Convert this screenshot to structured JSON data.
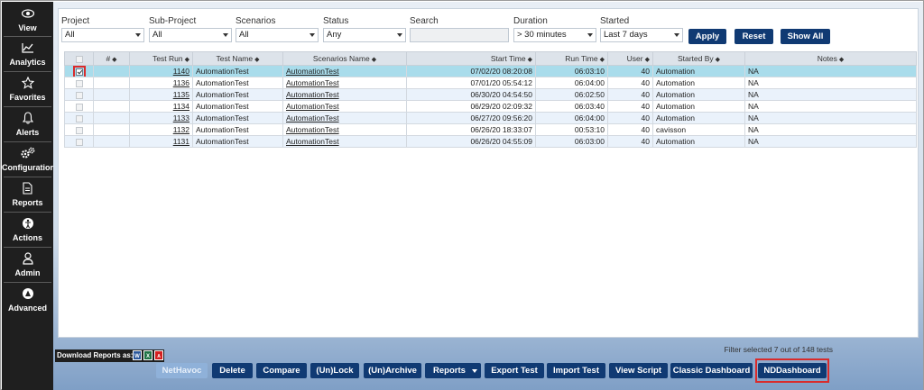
{
  "sidebar": {
    "items": [
      {
        "label": "View",
        "icon": "eye-icon"
      },
      {
        "label": "Analytics",
        "icon": "line-chart-icon"
      },
      {
        "label": "Favorites",
        "icon": "star-icon"
      },
      {
        "label": "Alerts",
        "icon": "bell-icon"
      },
      {
        "label": "Configuration",
        "icon": "gears-icon"
      },
      {
        "label": "Reports",
        "icon": "document-icon"
      },
      {
        "label": "Actions",
        "icon": "person-circle-icon"
      },
      {
        "label": "Admin",
        "icon": "user-icon"
      },
      {
        "label": "Advanced",
        "icon": "advanced-circle-icon"
      }
    ]
  },
  "filters": {
    "project": {
      "label": "Project",
      "value": "All"
    },
    "sub_project": {
      "label": "Sub-Project",
      "value": "All"
    },
    "scenarios": {
      "label": "Scenarios",
      "value": "All"
    },
    "status": {
      "label": "Status",
      "value": "Any"
    },
    "search": {
      "label": "Search",
      "value": ""
    },
    "duration": {
      "label": "Duration",
      "value": "> 30 minutes"
    },
    "started": {
      "label": "Started",
      "value": "Last 7 days"
    },
    "apply_label": "Apply",
    "reset_label": "Reset",
    "show_all_label": "Show All"
  },
  "table": {
    "columns": [
      "#",
      "Test Run",
      "Test Name",
      "Scenarios Name",
      "Start Time",
      "Run Time",
      "User",
      "Started By",
      "Notes"
    ],
    "rows": [
      {
        "checked": true,
        "test_run": "1140",
        "test_name": "AutomationTest",
        "scenario": "AutomationTest",
        "start_time": "07/02/20 08:20:08",
        "run_time": "06:03:10",
        "user": "40",
        "started_by": "Automation",
        "notes": "NA"
      },
      {
        "checked": false,
        "test_run": "1136",
        "test_name": "AutomationTest",
        "scenario": "AutomationTest",
        "start_time": "07/01/20 05:54:12",
        "run_time": "06:04:00",
        "user": "40",
        "started_by": "Automation",
        "notes": "NA"
      },
      {
        "checked": false,
        "test_run": "1135",
        "test_name": "AutomationTest",
        "scenario": "AutomationTest",
        "start_time": "06/30/20 04:54:50",
        "run_time": "06:02:50",
        "user": "40",
        "started_by": "Automation",
        "notes": "NA"
      },
      {
        "checked": false,
        "test_run": "1134",
        "test_name": "AutomationTest",
        "scenario": "AutomationTest",
        "start_time": "06/29/20 02:09:32",
        "run_time": "06:03:40",
        "user": "40",
        "started_by": "Automation",
        "notes": "NA"
      },
      {
        "checked": false,
        "test_run": "1133",
        "test_name": "AutomationTest",
        "scenario": "AutomationTest",
        "start_time": "06/27/20 09:56:20",
        "run_time": "06:04:00",
        "user": "40",
        "started_by": "Automation",
        "notes": "NA"
      },
      {
        "checked": false,
        "test_run": "1132",
        "test_name": "AutomationTest",
        "scenario": "AutomationTest",
        "start_time": "06/26/20 18:33:07",
        "run_time": "00:53:10",
        "user": "40",
        "started_by": "cavisson",
        "notes": "NA"
      },
      {
        "checked": false,
        "test_run": "1131",
        "test_name": "AutomationTest",
        "scenario": "AutomationTest",
        "start_time": "06/26/20 04:55:09",
        "run_time": "06:03:00",
        "user": "40",
        "started_by": "Automation",
        "notes": "NA"
      }
    ]
  },
  "footer": {
    "filter_status": "Filter selected 7 out of 148 tests",
    "download_label": "Download Reports as:",
    "buttons": {
      "nethavoc": "NetHavoc",
      "delete": "Delete",
      "compare": "Compare",
      "unlock": "(Un)Lock",
      "unarchive": "(Un)Archive",
      "reports": "Reports",
      "export": "Export Test",
      "import": "Import Test",
      "view_script": "View Script",
      "classic_dashboard": "Classic Dashboard",
      "nd_dashboard": "NDDashboard"
    }
  },
  "colors": {
    "sidebar_bg": "#1f1f1f",
    "button_bg": "#103a73",
    "selected_row": "#a9dceb",
    "highlight_red": "#d92b2b"
  }
}
